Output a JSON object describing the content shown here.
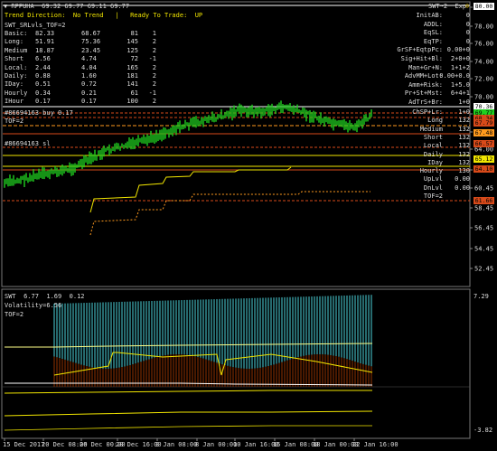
{
  "colors": {
    "bg": "#000000",
    "grid": "#2a2a2a",
    "candle": "#1fd01f",
    "yellow": "#f2e600",
    "lightyellow": "#ffff88",
    "orange": "#ff9a1e",
    "red": "#d84a1a",
    "white": "#ffffff",
    "cyan": "#3fb0b8",
    "darkred": "#7a2a00"
  },
  "header": {
    "symbol_line": "▼ RPPUHA  69.32 69.77 69.11 69.77",
    "right_label": "SWT~2  Exp",
    "trend_line": "Trend Direction:  No Trend   |   Ready To Trade:  UP",
    "indicator_name": "SWT_SRLvls_TOF=2"
  },
  "stats_table": {
    "rows": [
      [
        "Basic:",
        "82.33",
        "68.67",
        "81",
        "1"
      ],
      [
        "Long:",
        "51.91",
        "75.36",
        "145",
        "2"
      ],
      [
        "Medium",
        "18.87",
        "23.45",
        "125",
        "2"
      ],
      [
        "Short",
        "6.56",
        "4.74",
        "72",
        "-1"
      ],
      [
        "Local:",
        "2.44",
        "4.04",
        "165",
        "2"
      ],
      [
        "Daily:",
        "0.88",
        "1.60",
        "181",
        "2"
      ],
      [
        "IDay:",
        "0.51",
        "0.72",
        "141",
        "2"
      ],
      [
        "Hourly",
        "0.34",
        "0.21",
        "61",
        "-1"
      ],
      [
        "IHour",
        "0.17",
        "0.17",
        "100",
        "2"
      ]
    ]
  },
  "right_list": [
    "InitAB:",
    "ADDL:",
    "EqSL:",
    "EqTP:",
    "GrSF+EqtpPc:",
    "Sig+Hit+Bl:",
    "Man+Gr+N:",
    "AdvMM+Lot:",
    "Amm+Risk:",
    "Pr+St+Mst:",
    "AdTrS+Br:"
  ],
  "right_values": [
    "0",
    "0",
    "0",
    "0",
    "0.00+0",
    "2+0+0",
    "1+1+2",
    "0.00+0.0",
    "1+5.0",
    "6+4+1",
    "1+0"
  ],
  "level_list": [
    [
      "ChSP+Lr:",
      "1+0"
    ],
    [
      "Long",
      "132"
    ],
    [
      "Medium",
      "132"
    ],
    [
      "Short",
      "132"
    ],
    [
      "Local",
      "132"
    ],
    [
      "Daily",
      "132"
    ],
    [
      "IDay",
      "132"
    ],
    [
      "Hourly",
      "130"
    ],
    [
      "UpLvl",
      "0.00"
    ],
    [
      "DnLvl",
      "0.00"
    ],
    [
      "TOF=2",
      ""
    ]
  ],
  "chart_labels": {
    "order1": "#86694163 buy 0.17",
    "tof": "TOF=2",
    "order2": "#86694163 sl"
  },
  "price_axis": [
    "80.00",
    "78.00",
    "76.00",
    "74.00",
    "72.00",
    "70.00",
    "68.00",
    "66.00",
    "64.00",
    "62.40",
    "60.45",
    "58.45",
    "56.45",
    "54.45",
    "52.45"
  ],
  "price_tags": [
    {
      "label": "80.00",
      "color": "#ffffff"
    },
    {
      "label": "70.36",
      "color": "#ffffff"
    },
    {
      "label": "69.77",
      "color": "#1fd01f"
    },
    {
      "label": "68.34",
      "color": "#d84a1a"
    },
    {
      "label": "67.79",
      "color": "#d84a1a"
    },
    {
      "label": "67.48",
      "color": "#ff9a1e"
    },
    {
      "label": "66.57",
      "color": "#d84a1a"
    },
    {
      "label": "65.12",
      "color": "#f2e600"
    },
    {
      "label": "64.10",
      "color": "#d84a1a"
    },
    {
      "label": "61.66",
      "color": "#d84a1a"
    }
  ],
  "sub_panel": {
    "title": "SWT  6.77  1.69  0.12",
    "volatility": "Volatility=6.56",
    "tof": "TOF=2",
    "axis_top": "7.29",
    "axis_bottom": "-3.82"
  },
  "time_axis": [
    "15 Dec 2017",
    "20 Dec 08:00",
    "26 Dec 00:00",
    "28 Dec 16:00",
    "3 Jan 08:00",
    "8 Jan 00:00",
    "10 Jan 16:00",
    "15 Jan 08:00",
    "18 Jan 00:00",
    "22 Jan 16:00"
  ]
}
